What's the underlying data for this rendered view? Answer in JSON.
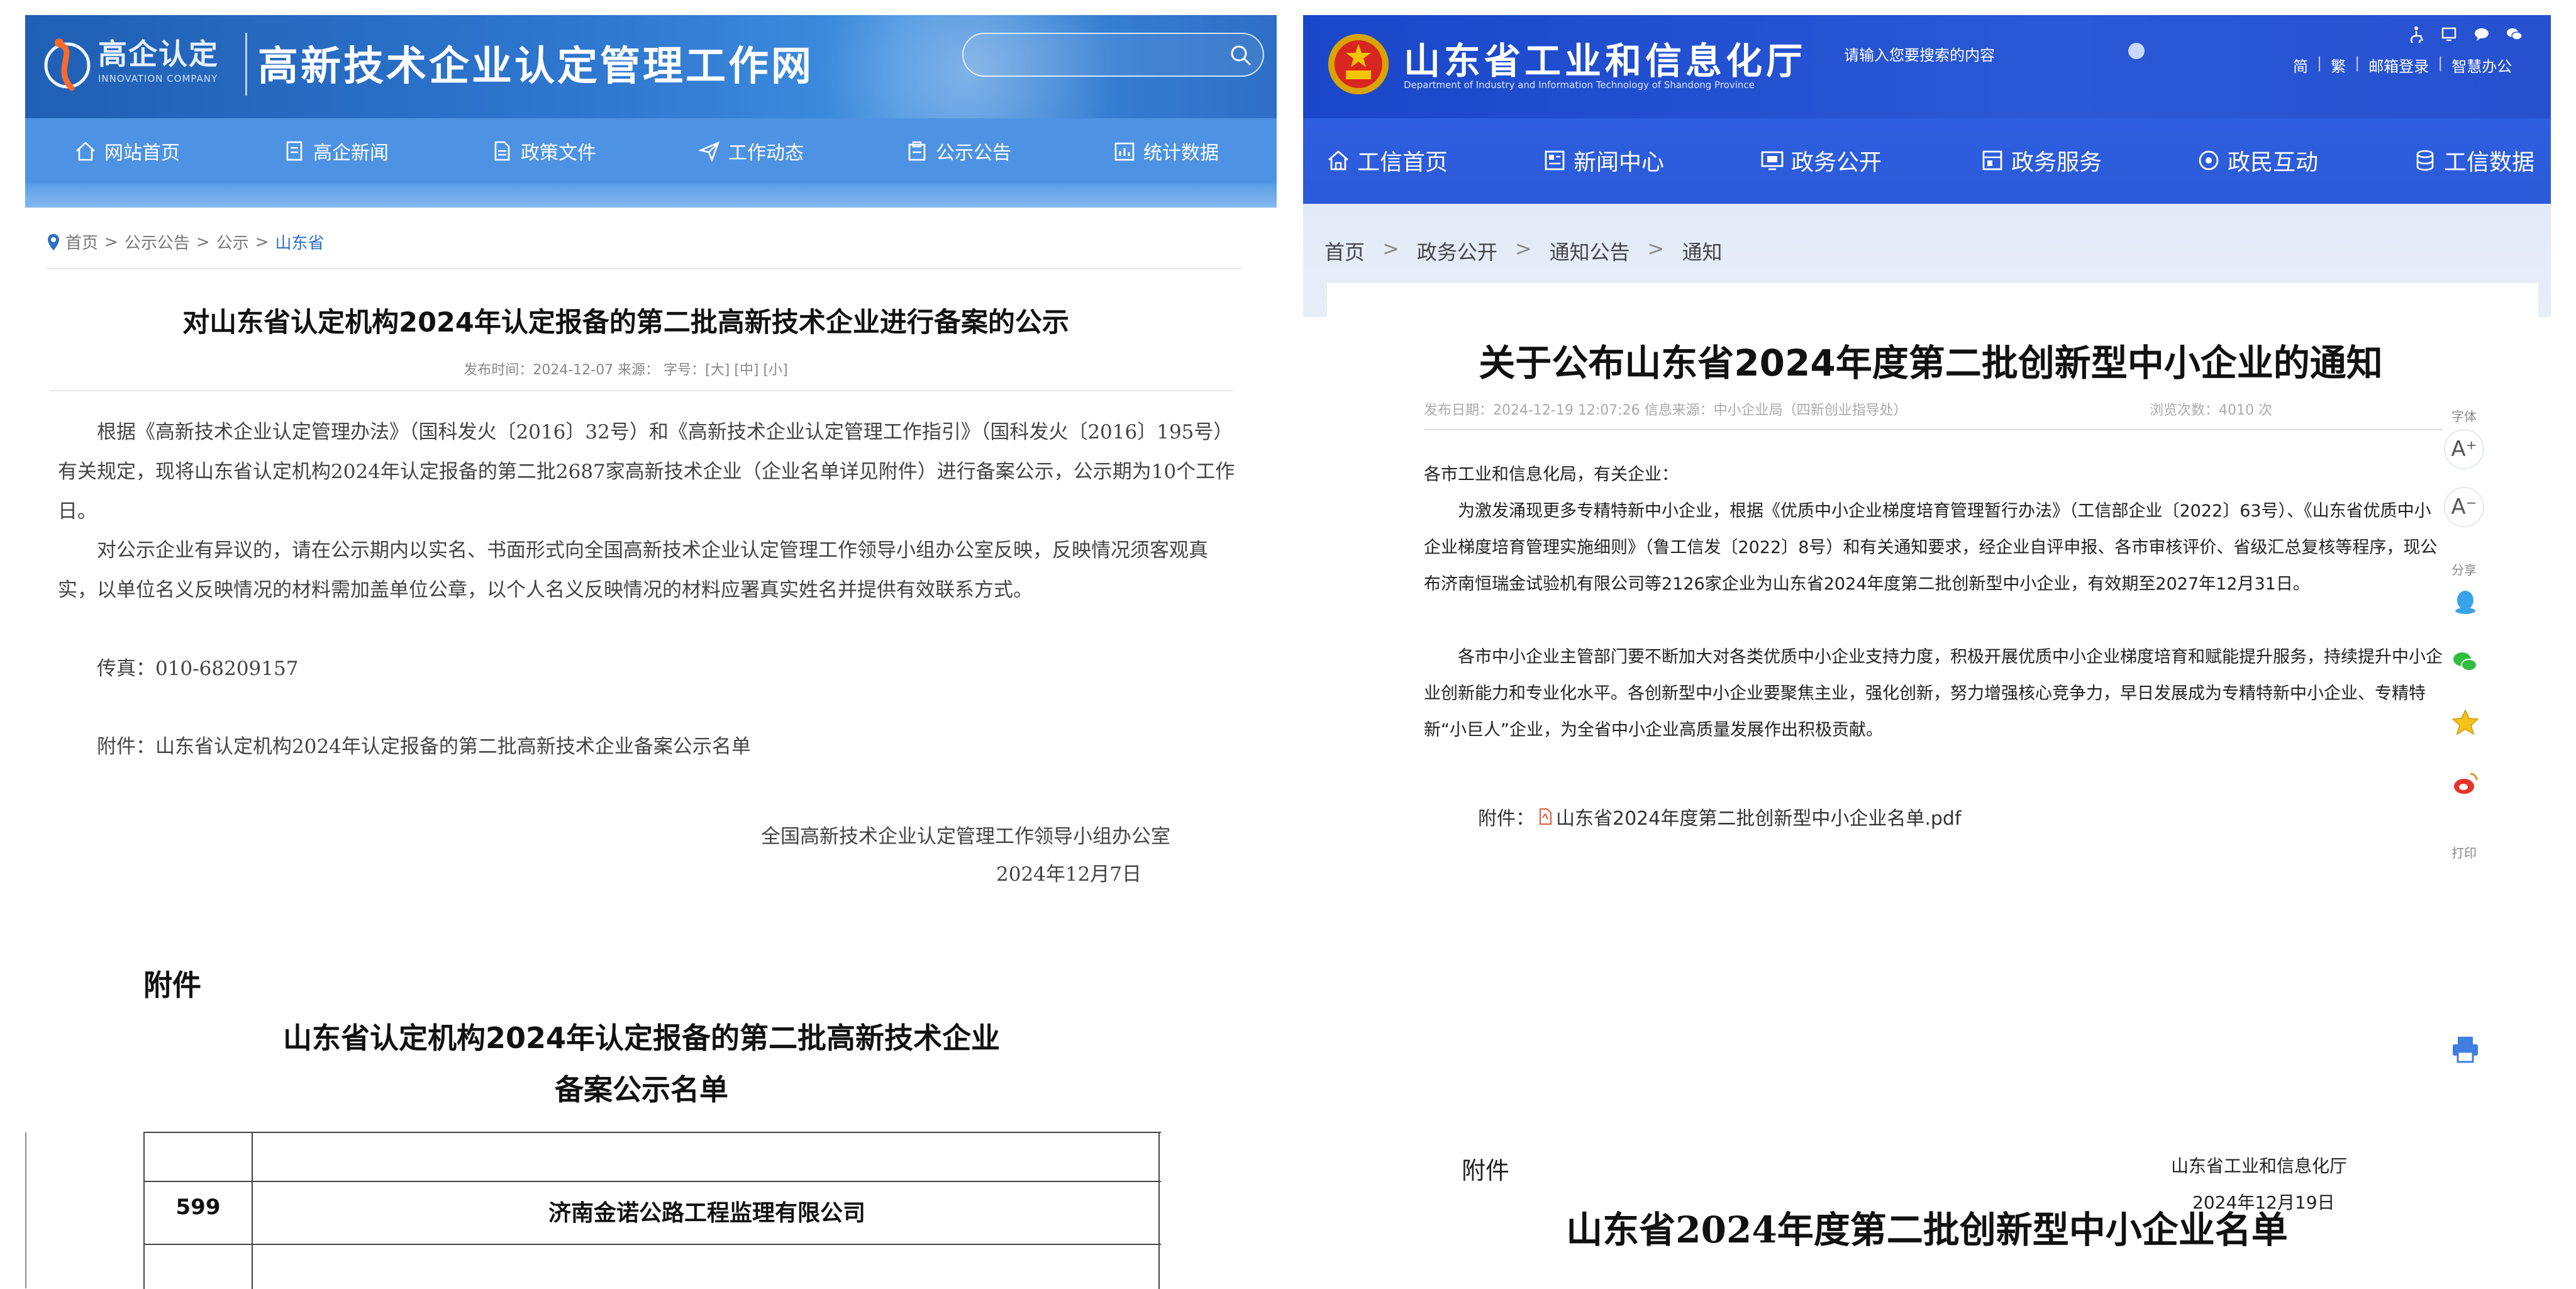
{
  "left": {
    "logo": {
      "brand": "高企认定",
      "sub": "INNOVATION COMPANY"
    },
    "site_title": "高新技术企业认定管理工作网",
    "nav": [
      {
        "label": "网站首页",
        "icon": "home-icon"
      },
      {
        "label": "高企新闻",
        "icon": "document-icon"
      },
      {
        "label": "政策文件",
        "icon": "file-icon"
      },
      {
        "label": "工作动态",
        "icon": "send-icon"
      },
      {
        "label": "公示公告",
        "icon": "clipboard-icon"
      },
      {
        "label": "统计数据",
        "icon": "chart-icon"
      }
    ],
    "breadcrumb": [
      "首页",
      "公示公告",
      "公示",
      "山东省"
    ],
    "breadcrumb_sep": ">",
    "article": {
      "title": "对山东省认定机构2024年认定报备的第二批高新技术企业进行备案的公示",
      "meta": "发布时间：2024-12-07 来源：        字号：[大] [中] [小]",
      "paragraphs": [
        "根据《高新技术企业认定管理办法》（国科发火〔2016〕32号）和《高新技术企业认定管理工作指引》（国科发火〔2016〕195号）有关规定，现将山东省认定机构2024年认定报备的第二批2687家高新技术企业（企业名单详见附件）进行备案公示，公示期为10个工作日。",
        "对公示企业有异议的，请在公示期内以实名、书面形式向全国高新技术企业认定管理工作领导小组办公室反映，反映情况须客观真实，以单位名义反映情况的材料需加盖单位公章，以个人名义反映情况的材料应署真实姓名并提供有效联系方式。",
        "传真：010-68209157",
        "附件：山东省认定机构2024年认定报备的第二批高新技术企业备案公示名单"
      ],
      "sign_org": "全国高新技术企业认定管理工作领导小组办公室",
      "sign_date": "2024年12月7日"
    },
    "doc": {
      "attachment_label": "附件",
      "title_line1": "山东省认定机构2024年认定报备的第二批高新技术企业",
      "title_line2": "备案公示名单",
      "row_number": "599",
      "row_company": "济南金诺公路工程监理有限公司"
    }
  },
  "right": {
    "title": "山东省工业和信息化厅",
    "subtitle": "Department of Industry and Information Technology of Shandong Province",
    "search_placeholder": "请输入您要搜索的内容",
    "links": [
      "简",
      "繁",
      "邮箱登录",
      "智慧办公"
    ],
    "nav": [
      {
        "label": "工信首页",
        "icon": "home-icon"
      },
      {
        "label": "新闻中心",
        "icon": "news-icon"
      },
      {
        "label": "政务公开",
        "icon": "monitor-icon"
      },
      {
        "label": "政务服务",
        "icon": "service-icon"
      },
      {
        "label": "政民互动",
        "icon": "chat-icon"
      },
      {
        "label": "工信数据",
        "icon": "database-icon"
      }
    ],
    "breadcrumb": [
      "首页",
      "政务公开",
      "通知公告",
      "通知"
    ],
    "breadcrumb_sep": ">",
    "article": {
      "title": "关于公布山东省2024年度第二批创新型中小企业的通知",
      "meta": "发布日期：2024-12-19 12:07:26    信息来源：中小企业局（四新创业指导处）",
      "views": "浏览次数：4010   次",
      "paragraphs": [
        "各市工业和信息化局，有关企业：",
        "为激发涌现更多专精特新中小企业，根据《优质中小企业梯度培育管理暂行办法》（工信部企业〔2022〕63号）、《山东省优质中小企业梯度培育管理实施细则》（鲁工信发〔2022〕8号）和有关通知要求，经企业自评申报、各市审核评价、省级汇总复核等程序，现公布济南恒瑞金试验机有限公司等2126家企业为山东省2024年度第二批创新型中小企业，有效期至2027年12月31日。",
        "各市中小企业主管部门要不断加大对各类优质中小企业支持力度，积极开展优质中小企业梯度培育和赋能提升服务，持续提升中小企业创新能力和专业化水平。各创新型中小企业要聚焦主业，强化创新，努力增强核心竞争力，早日发展成为专精特新中小企业、专精特新“小巨人”企业，为全省中小企业高质量发展作出积极贡献。"
      ],
      "attachment_label": "附件：",
      "attachment_file": "山东省2024年度第二批创新型中小企业名单.pdf",
      "sign_org": "山东省工业和信息化厅",
      "sign_date": "2024年12月19日"
    },
    "side": {
      "font_label": "字体",
      "font_inc": "A⁺",
      "font_dec": "A⁻",
      "share_label": "分享",
      "print_label": "打印"
    },
    "doc": {
      "attachment_label": "附件",
      "list_title": "山东省2024年度第二批创新型中小企业名单"
    }
  }
}
